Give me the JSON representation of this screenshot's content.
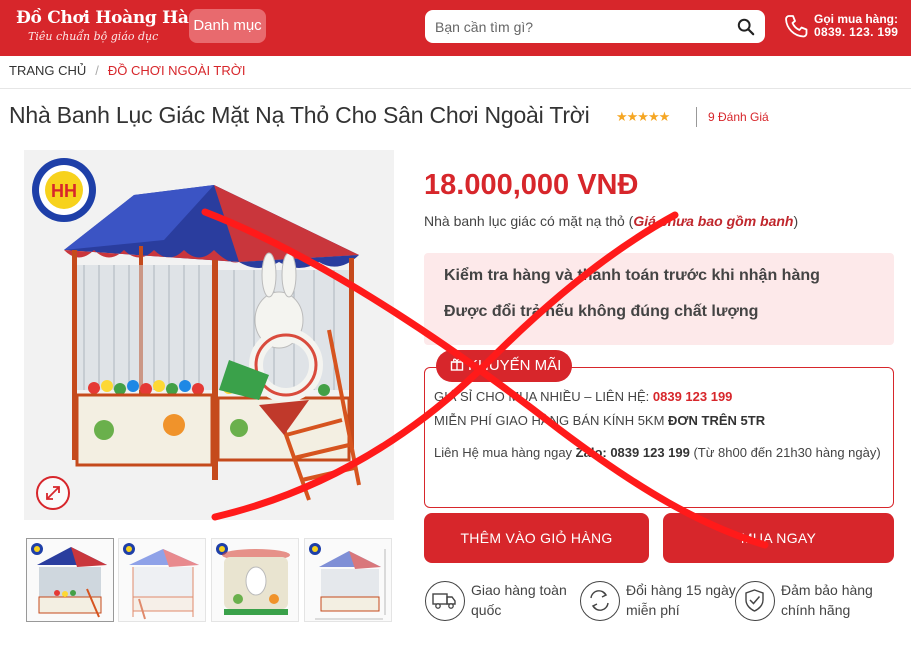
{
  "header": {
    "logo_title": "Đồ Chơi Hoàng Hà",
    "logo_subtitle": "Tiêu chuẩn bộ giáo dục",
    "menu_label": "Danh mục",
    "search_placeholder": "Bạn cần tìm gì?",
    "hotline_label": "Gọi mua hàng:",
    "hotline_number": "0839. 123. 199"
  },
  "breadcrumb": {
    "home": "TRANG CHỦ",
    "separator": "/",
    "current": "ĐỒ CHƠI NGOÀI TRỜI"
  },
  "product": {
    "title": "Nhà Banh Lục Giác Mặt Nạ Thỏ Cho Sân Chơi Ngoài Trời",
    "rating_stars": 5,
    "stars_text": "★★★★★",
    "review_count": "9 Đánh Giá",
    "price": "18.000,000 VNĐ",
    "desc_plain": "Nhà banh lục giác có mặt nạ thỏ (",
    "desc_note": "Giá chưa bao gồm banh",
    "desc_close": ")",
    "image_alt": "Nhà banh lục giác mặt nạ thỏ",
    "image_logo_text": "HH"
  },
  "assurances": [
    "Kiểm tra hàng và thanh toán trước khi nhận hàng",
    "Được đổi trả nếu không đúng chất lượng"
  ],
  "promo": {
    "badge": "KHUYẾN MÃI",
    "line1_text": "GIÁ SỈ CHO MUA NHIỀU – LIÊN HỆ: ",
    "line1_phone": "0839 123 199",
    "line2_text": "MIỄN PHÍ GIAO HÀNG BÁN KÍNH 5KM ",
    "line2_bold": "ĐƠN TRÊN 5TR",
    "line3_text": "Liên Hệ mua hàng ngay ",
    "line3_bold": "Zalo: 0839 123 199",
    "line3_tail": " (Từ 8h00 đến 21h30 hàng ngày)"
  },
  "actions": {
    "add_to_cart": "THÊM VÀO GIỎ HÀNG",
    "buy_now": "MUA NGAY"
  },
  "features": [
    {
      "line1": "Giao hàng toàn",
      "line2": "quốc",
      "icon": "truck-icon"
    },
    {
      "line1": "Đổi hàng 15 ngày",
      "line2": "miễn phí",
      "icon": "exchange-icon"
    },
    {
      "line1": "Đảm bảo hàng",
      "line2": "chính hãng",
      "icon": "shield-check-icon"
    }
  ],
  "colors": {
    "brand_red": "#d7262b",
    "assure_bg": "#fde9ea",
    "star": "#f5a623",
    "cross_mark": "#ff1a1a"
  }
}
